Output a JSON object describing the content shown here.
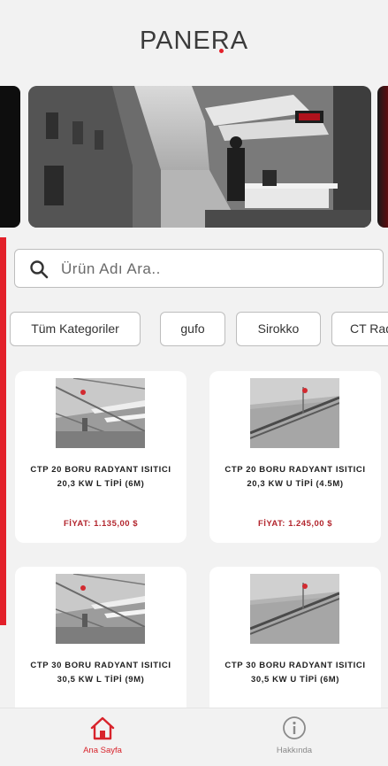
{
  "app": {
    "logo_text": "PANERA"
  },
  "search": {
    "placeholder": "Ürün Adı Ara.."
  },
  "categories": [
    "Tüm Kategoriler",
    "gufo",
    "Sirokko",
    "CT Rad"
  ],
  "products": [
    {
      "name": "CTP 20 BORU RADYANT ISITICI 20,3 KW L TİPİ (6M)",
      "price": "FİYAT: 1.135,00 $"
    },
    {
      "name": "CTP 20 BORU RADYANT ISITICI 20,3 KW U TİPİ (4.5M)",
      "price": "FİYAT: 1.245,00 $"
    },
    {
      "name": "CTP 30 BORU RADYANT ISITICI 30,5 KW L TİPİ (9M)",
      "price": ""
    },
    {
      "name": "CTP 30 BORU RADYANT ISITICI 30,5 KW U TİPİ (6M)",
      "price": ""
    }
  ],
  "tabs": [
    {
      "label": "Ana Sayfa",
      "icon": "home-icon",
      "active": true
    },
    {
      "label": "Hakkında",
      "icon": "info-icon",
      "active": false
    }
  ],
  "colors": {
    "accent": "#e3202a",
    "price": "#b3262e",
    "background": "#f2f2f2",
    "inactive_tab": "#8a8a8a"
  }
}
